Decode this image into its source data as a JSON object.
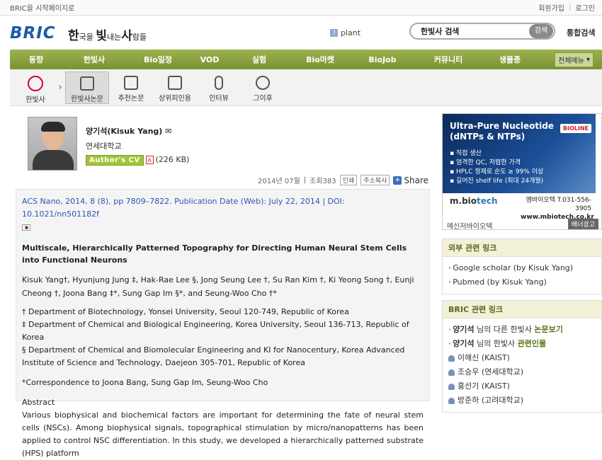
{
  "topbar": {
    "left": "BRIC을 시작페이지로",
    "join": "회원가입",
    "login": "로그인"
  },
  "header": {
    "logo": "BRIC",
    "slogan_parts": [
      "한",
      "국을 ",
      "빛",
      "내는",
      "사",
      "람들"
    ],
    "tag": "plant",
    "search_value": "한빛사 검색",
    "search_btn": "검색",
    "all_search": "통합검색"
  },
  "nav": {
    "items": [
      "동향",
      "한빛사",
      "Bio일정",
      "VOD",
      "실험",
      "Bio마켓",
      "BioJob",
      "커뮤니티",
      "생물종"
    ],
    "menu_btn": "전체메뉴"
  },
  "subnav": {
    "items": [
      "한빛사",
      "한빛사논문",
      "추천논문",
      "상위피인용",
      "인터뷰",
      "그이후"
    ],
    "active": "한빛사논문"
  },
  "profile": {
    "name": "양기석(Kisuk Yang)",
    "affiliation": "연세대학교",
    "cv_badge": "Author's CV",
    "cv_size": "(226 KB)"
  },
  "meta": {
    "date": "2014년 07월",
    "views": "조회383",
    "print": "인쇄",
    "copy_url": "주소복사",
    "share": "Share"
  },
  "article": {
    "citation": "ACS Nano, 2014, 8 (8), pp 7809–7822. Publication Date (Web): July 22, 2014 | DOI: 10.1021/nn501182f",
    "title": "Multiscale, Hierarchically Patterned Topography for Directing Human Neural Stem Cells into Functional Neurons",
    "authors": "Kisuk Yang†, Hyunjung Jung ‡, Hak-Rae Lee §, Jong Seung Lee †, Su Ran Kim †, Ki Yeong Song †, Eunji Cheong †, Joona Bang ‡*, Sung Gap Im §*, and Seung-Woo Cho †*",
    "affiliations": [
      "† Department of Biotechnology, Yonsei University, Seoul 120-749, Republic of Korea",
      "‡ Department of Chemical and Biological Engineering, Korea University, Seoul 136-713, Republic of Korea",
      "§ Department of Chemical and Biomolecular Engineering and KI for Nanocentury, Korea Advanced Institute of Science and Technology, Daejeon 305-701, Republic of Korea"
    ],
    "correspondence": "*Correspondence to Joona Bang, Sung Gap Im, Seung-Woo Cho",
    "abstract_label": "Abstract",
    "abstract": "Various biophysical and biochemical factors are important for determining the fate of neural stem cells (NSCs). Among biophysical signals, topographical stimulation by micro/nanopatterns has been applied to control NSC differentiation. In this study, we developed a hierarchically patterned substrate (HPS) platform"
  },
  "ad": {
    "title_line1": "Ultra-Pure Nucleotide",
    "title_line2": "(dNTPs & NTPs)",
    "brand": "BIOLINE",
    "bullets": [
      "▪ 직접 생산",
      "▪ 엄격한 QC, 저렴한 가격",
      "▪ HPLC 정제로 순도 ≥ 99% 이상",
      "▪ 길어진 shelf life (최대 24개월)"
    ],
    "mb_logo_1": "m.bio",
    "mb_logo_2": "tech",
    "phone": "엠바이오텍 T.031-556-3905",
    "web": "www.mbiotech.co.kr",
    "company": "메신저바이오텍",
    "banner_btn": "배너광고"
  },
  "external_links": {
    "heading": "외부 관련 링크",
    "items": [
      "Google scholar (by Kisuk Yang)",
      "Pubmed (by Kisuk Yang)"
    ]
  },
  "bric_links": {
    "heading": "BRIC 관련 링크",
    "other_papers_name": "양기석",
    "other_papers_mid": " 님의 다른 한빛사 ",
    "other_papers_link": "논문보기",
    "related_name": "양기석",
    "related_mid": " 님의 한빛사 ",
    "related_link": "관련인물",
    "people": [
      "이해신 (KAIST)",
      "조승우 (연세대학교)",
      "홍선기 (KAIST)",
      "방준하 (고려대학교)"
    ]
  }
}
